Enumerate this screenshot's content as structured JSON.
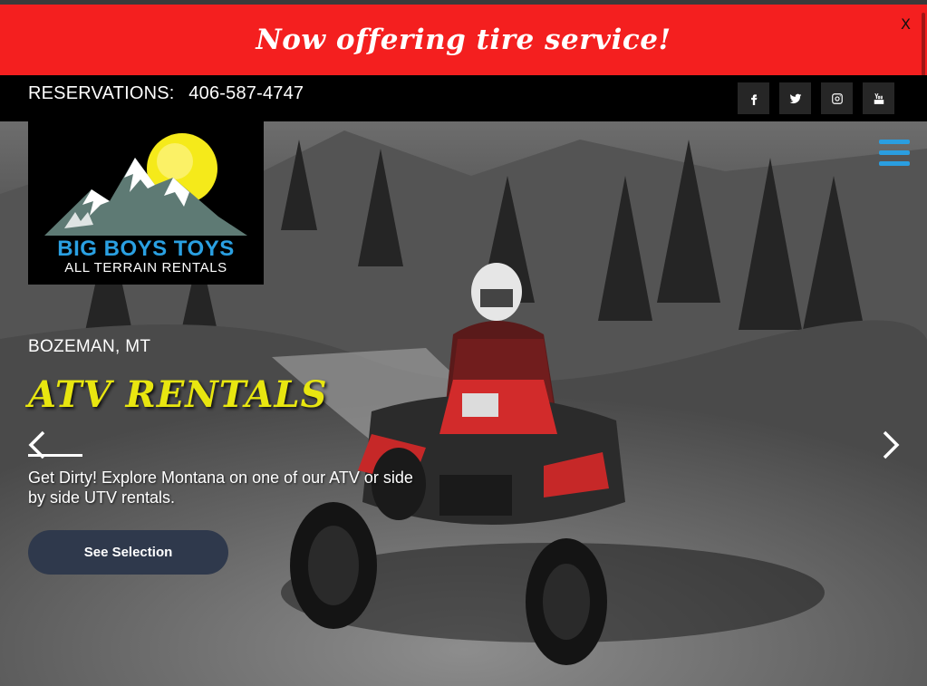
{
  "promo": {
    "text": "Now offering tire service!",
    "close_label": "X"
  },
  "header": {
    "reservations_label": "RESERVATIONS:",
    "phone": "406-587-4747",
    "social": [
      {
        "name": "facebook",
        "icon": "f"
      },
      {
        "name": "twitter",
        "icon": "twitter-bird"
      },
      {
        "name": "instagram",
        "icon": "instagram-camera"
      },
      {
        "name": "youtube",
        "icon": "You"
      }
    ]
  },
  "logo": {
    "line1": "BIG BOYS TOYS",
    "line2": "ALL TERRAIN RENTALS"
  },
  "hero": {
    "location": "BOZEMAN, MT",
    "headline": "ATV RENTALS",
    "description": "Get Dirty! Explore Montana on one of our ATV or side by side UTV rentals.",
    "cta_label": "See Selection"
  },
  "colors": {
    "promo_bg": "#f41f1f",
    "headline": "#e8e610",
    "menu_accent": "#2a9ee0",
    "cta_bg": "#2f394c"
  }
}
